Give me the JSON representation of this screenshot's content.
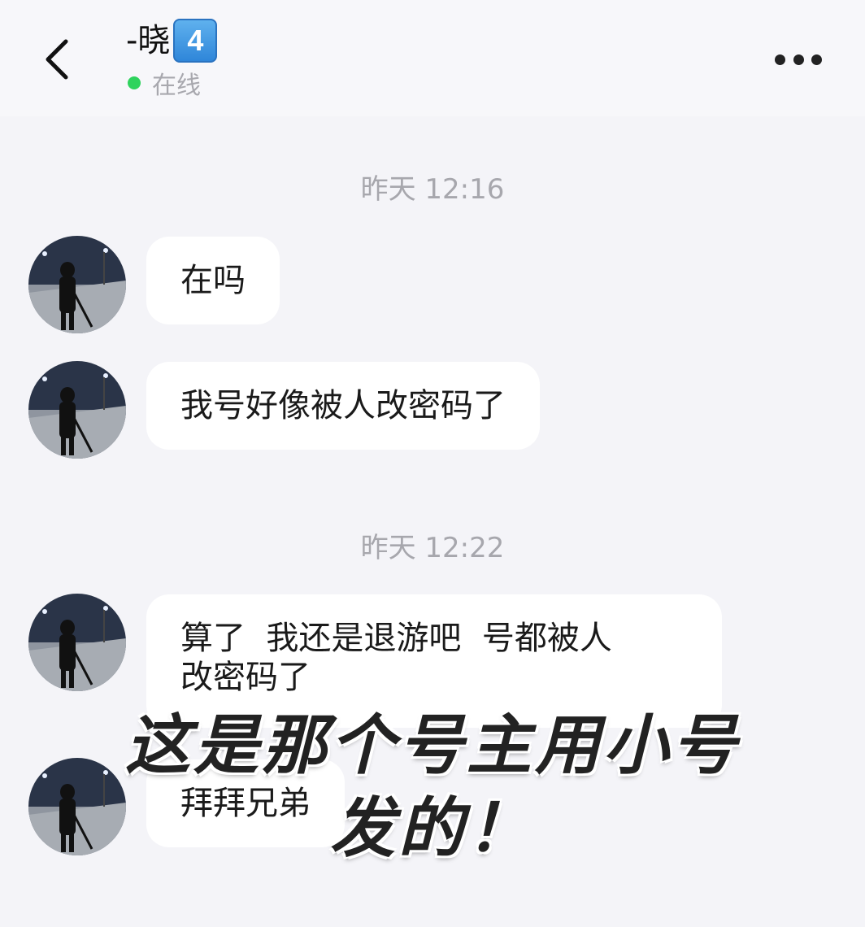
{
  "header": {
    "contact_name": "-晓",
    "contact_badge": "4",
    "status_text": "在线",
    "status_color": "#2fd35d"
  },
  "messages": [
    {
      "timestamp": "昨天 12:16"
    },
    {
      "text": "在吗"
    },
    {
      "text": "我号好像被人改密码了"
    },
    {
      "timestamp": "昨天 12:22"
    },
    {
      "text_line1": "算了  我还是退游吧  号都被人",
      "text_line2": "改密码了"
    },
    {
      "text": "拜拜兄弟"
    }
  ],
  "overlay": {
    "line1": "这是那个号主用小号",
    "line2": "发的！"
  }
}
